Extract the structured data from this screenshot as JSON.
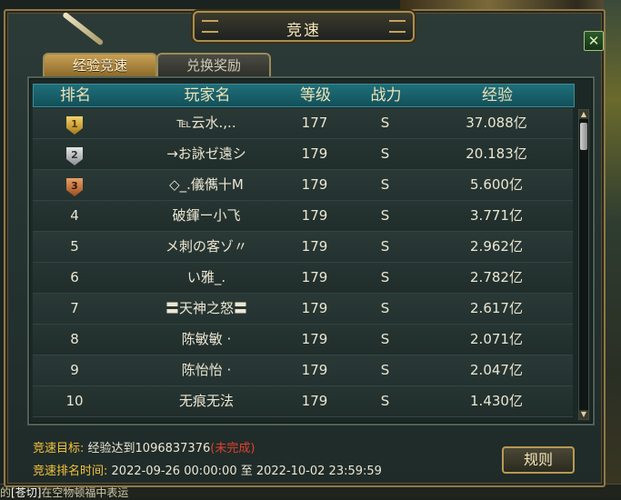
{
  "window": {
    "title": "竞速",
    "close_label": "✕",
    "tabs": [
      {
        "label": "经验竞速",
        "active": true
      },
      {
        "label": "兑换奖励",
        "active": false
      }
    ]
  },
  "table": {
    "headers": {
      "rank": "排名",
      "name": "玩家名",
      "level": "等级",
      "power": "战力",
      "exp": "经验"
    },
    "rows": [
      {
        "rank": "1",
        "medal": "gold",
        "name": "℡云水.,..",
        "level": "177",
        "power": "S",
        "exp": "37.088亿"
      },
      {
        "rank": "2",
        "medal": "silver",
        "name": "→お詠ゼ遠シ",
        "level": "179",
        "power": "S",
        "exp": "20.183亿"
      },
      {
        "rank": "3",
        "medal": "bronze",
        "name": "◇_.儀㒞十M",
        "level": "179",
        "power": "S",
        "exp": "5.600亿"
      },
      {
        "rank": "4",
        "name": "破鍕ー小飞",
        "level": "179",
        "power": "S",
        "exp": "3.771亿"
      },
      {
        "rank": "5",
        "name": "メ刺の客ゾ〃",
        "level": "179",
        "power": "S",
        "exp": "2.962亿"
      },
      {
        "rank": "6",
        "name": "い雅_.",
        "level": "179",
        "power": "S",
        "exp": "2.782亿"
      },
      {
        "rank": "7",
        "name": "〓天神之怒〓",
        "level": "179",
        "power": "S",
        "exp": "2.617亿"
      },
      {
        "rank": "8",
        "name": "陈敏敏 ·",
        "level": "179",
        "power": "S",
        "exp": "2.071亿"
      },
      {
        "rank": "9",
        "name": "陈怡怡 ·",
        "level": "179",
        "power": "S",
        "exp": "2.047亿"
      },
      {
        "rank": "10",
        "name": "无痕无法",
        "level": "179",
        "power": "S",
        "exp": "1.430亿"
      }
    ]
  },
  "footer": {
    "target_label": "竞速目标:",
    "target_value": "经验达到1096837376",
    "target_status": "(未完成)",
    "time_label": "竞速排名时间:",
    "time_value": "2022-09-26 00:00:00 至 2022-10-02 23:59:59",
    "rules_button": "规则"
  },
  "background": {
    "chat_prefix": "的",
    "chat_link": "[苍切]",
    "chat_suffix": "在空物顿福中表运"
  },
  "colors": {
    "accent_gold": "#f2c23a",
    "status_red": "#e0402a",
    "header_teal": "#1f6f7a"
  }
}
